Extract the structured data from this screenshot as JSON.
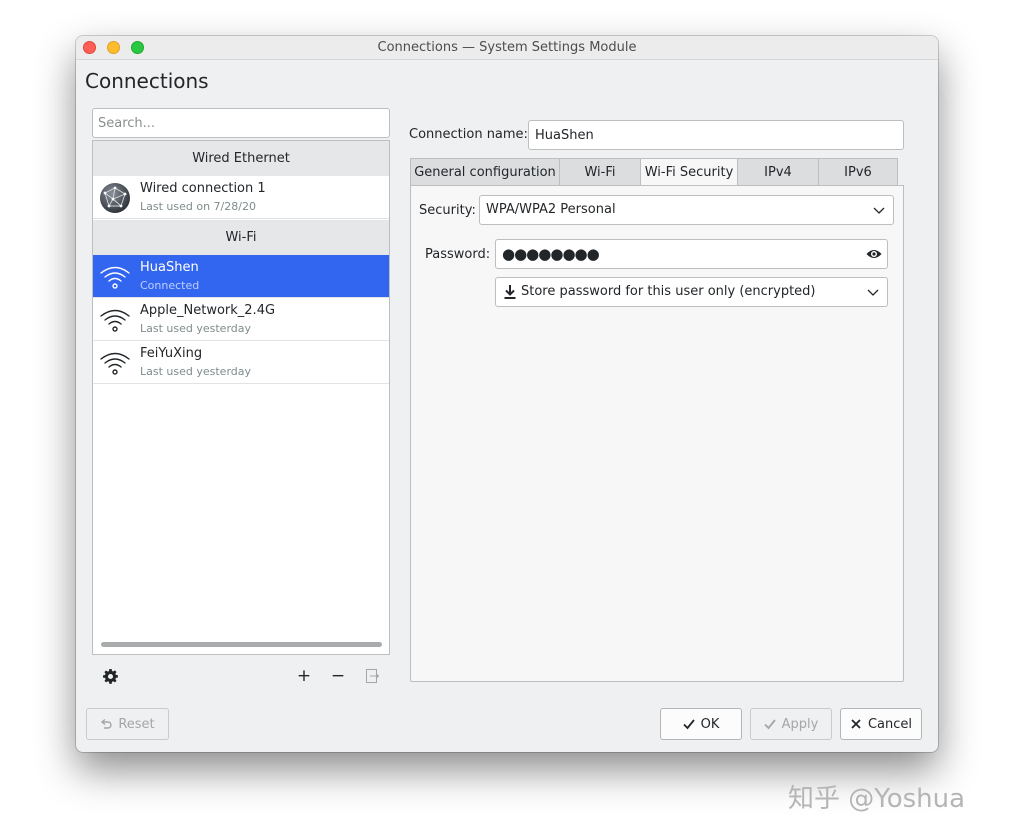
{
  "window": {
    "title": "Connections — System Settings Module",
    "heading": "Connections"
  },
  "search": {
    "placeholder": "Search..."
  },
  "list": {
    "sections": [
      {
        "header": "Wired Ethernet",
        "items": [
          {
            "name": "Wired connection 1",
            "sub": "Last used on 7/28/20",
            "icon": "network-globe-icon"
          }
        ]
      },
      {
        "header": "Wi-Fi",
        "items": [
          {
            "name": "HuaShen",
            "sub": "Connected",
            "icon": "wifi-icon",
            "selected": true
          },
          {
            "name": "Apple_Network_2.4G",
            "sub": "Last used yesterday",
            "icon": "wifi-icon"
          },
          {
            "name": "FeiYuXing",
            "sub": "Last used yesterday",
            "icon": "wifi-icon"
          }
        ]
      }
    ],
    "toolbar": {
      "configure_icon": "gear-icon",
      "add_label": "+",
      "remove_label": "−",
      "export_icon": "export-icon"
    }
  },
  "details": {
    "connection_name_label": "Connection name:",
    "connection_name": "HuaShen",
    "tabs": [
      {
        "label": "General configuration"
      },
      {
        "label": "Wi-Fi"
      },
      {
        "label": "Wi-Fi Security",
        "active": true
      },
      {
        "label": "IPv4"
      },
      {
        "label": "IPv6"
      }
    ],
    "security_label": "Security:",
    "security_value": "WPA/WPA2 Personal",
    "password_label": "Password:",
    "password_masked": "●●●●●●●●",
    "store_option": "Store password for this user only (encrypted)"
  },
  "buttons": {
    "reset": "Reset",
    "ok": "OK",
    "apply": "Apply",
    "cancel": "Cancel"
  },
  "watermark": "知乎 @Yoshua",
  "colors": {
    "selection": "#3366f0",
    "window_bg": "#eff0f1",
    "traffic_close": "#fe5f57",
    "traffic_minimize": "#febc2e",
    "traffic_maximize": "#28c840"
  }
}
